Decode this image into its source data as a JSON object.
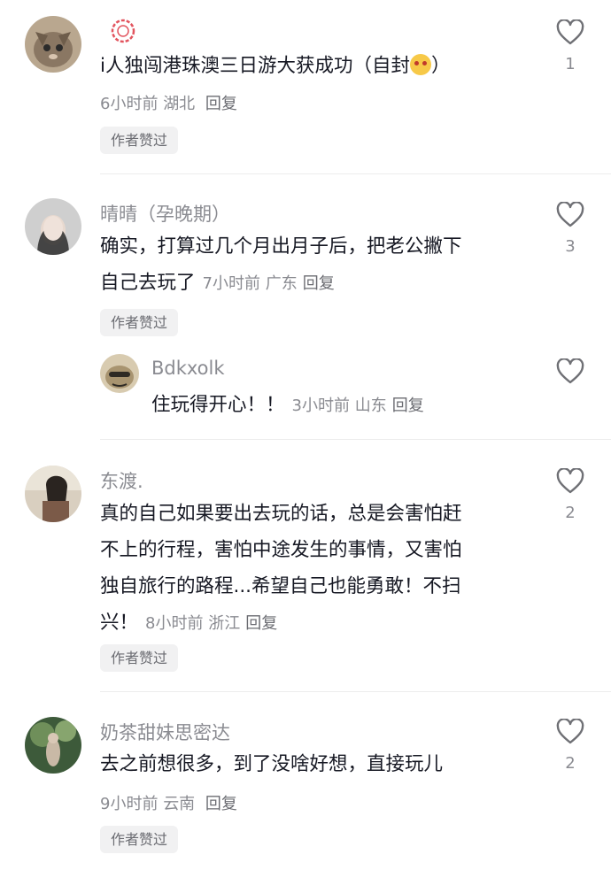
{
  "comments": [
    {
      "username": "",
      "text": "i人独闯港珠澳三日游大获成功（自封",
      "text_tail": "）",
      "time": "6小时前",
      "location": "湖北",
      "reply_label": "回复",
      "liked_label": "作者赞过",
      "like_count": "1"
    },
    {
      "username": "晴晴（孕晚期）",
      "text_line1": "确实，打算过几个月出月子后，把老公撇下",
      "text_line2": "自己去玩了",
      "time": "7小时前",
      "location": "广东",
      "reply_label": "回复",
      "liked_label": "作者赞过",
      "like_count": "3",
      "reply": {
        "username": "Bdkxolk",
        "text": "住玩得开心！！",
        "time": "3小时前",
        "location": "山东",
        "reply_label": "回复",
        "like_count": ""
      }
    },
    {
      "username": "东渡.",
      "text_line1": "真的自己如果要出去玩的话，总是会害怕赶",
      "text_line2": "不上的行程，害怕中途发生的事情，又害怕",
      "text_line3": "独自旅行的路程...希望自己也能勇敢！不扫",
      "text_line4": "兴！",
      "time": "8小时前",
      "location": "浙江",
      "reply_label": "回复",
      "liked_label": "作者赞过",
      "like_count": "2"
    },
    {
      "username": "奶茶甜妹思密达",
      "text": "去之前想很多，到了没啥好想，直接玩儿",
      "time": "9小时前",
      "location": "云南",
      "reply_label": "回复",
      "liked_label": "作者赞过",
      "like_count": "2"
    }
  ],
  "icons": {
    "like": "heart-outline-icon",
    "badge": "flower-badge-icon",
    "emoji": "face-emoji-icon"
  },
  "colors": {
    "text": "#161823",
    "secondary": "#8a8b91",
    "chip_bg": "#f1f1f2",
    "divider": "#ececec"
  }
}
